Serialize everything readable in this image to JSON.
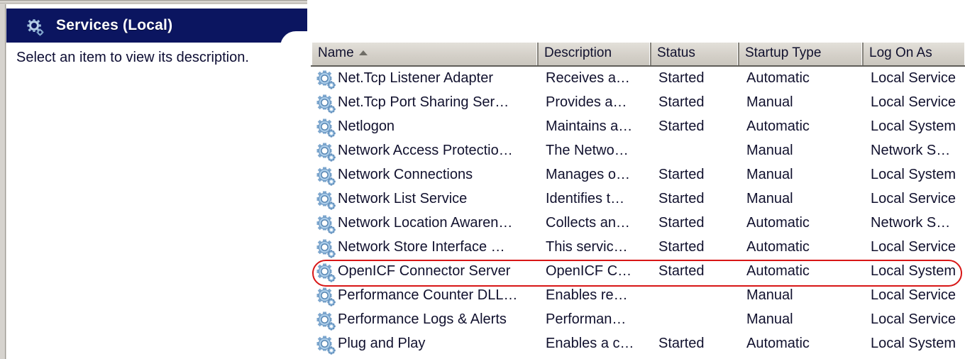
{
  "window": {
    "chrome_color": "#d6d3ce"
  },
  "left_pane": {
    "title": "Services (Local)",
    "title_icon": "gear-icon",
    "title_bar_color": "#0b1560",
    "description": "Select an item to view its description."
  },
  "list": {
    "columns": [
      {
        "label": "Name",
        "sorted": "ascending",
        "sort_glyph": "▲"
      },
      {
        "label": "Description"
      },
      {
        "label": "Status"
      },
      {
        "label": "Startup Type"
      },
      {
        "label": "Log On As"
      }
    ],
    "row_icon": "service-gear-icon",
    "rows": [
      {
        "name": "Net.Tcp Listener Adapter",
        "description": "Receives a…",
        "status": "Started",
        "startup": "Automatic",
        "logon": "Local Service"
      },
      {
        "name": "Net.Tcp Port Sharing Ser…",
        "description": "Provides a…",
        "status": "Started",
        "startup": "Manual",
        "logon": "Local Service"
      },
      {
        "name": "Netlogon",
        "description": "Maintains a…",
        "status": "Started",
        "startup": "Automatic",
        "logon": "Local System"
      },
      {
        "name": "Network Access Protectio…",
        "description": "The Netwo…",
        "status": "",
        "startup": "Manual",
        "logon": "Network S…"
      },
      {
        "name": "Network Connections",
        "description": "Manages o…",
        "status": "Started",
        "startup": "Manual",
        "logon": "Local System"
      },
      {
        "name": "Network List Service",
        "description": "Identifies t…",
        "status": "Started",
        "startup": "Manual",
        "logon": "Local Service"
      },
      {
        "name": "Network Location Awaren…",
        "description": "Collects an…",
        "status": "Started",
        "startup": "Automatic",
        "logon": "Network S…"
      },
      {
        "name": "Network Store Interface …",
        "description": "This servic…",
        "status": "Started",
        "startup": "Automatic",
        "logon": "Local Service"
      },
      {
        "name": "OpenICF Connector Server",
        "description": "OpenICF C…",
        "status": "Started",
        "startup": "Automatic",
        "logon": "Local System",
        "highlighted": true
      },
      {
        "name": "Performance Counter DLL…",
        "description": "Enables re…",
        "status": "",
        "startup": "Manual",
        "logon": "Local Service"
      },
      {
        "name": "Performance Logs & Alerts",
        "description": "Performan…",
        "status": "",
        "startup": "Manual",
        "logon": "Local Service"
      },
      {
        "name": "Plug and Play",
        "description": "Enables a c…",
        "status": "Started",
        "startup": "Automatic",
        "logon": "Local System"
      }
    ]
  },
  "annotation": {
    "type": "highlight-oval",
    "color": "#d81616",
    "target_row": "OpenICF Connector Server"
  }
}
